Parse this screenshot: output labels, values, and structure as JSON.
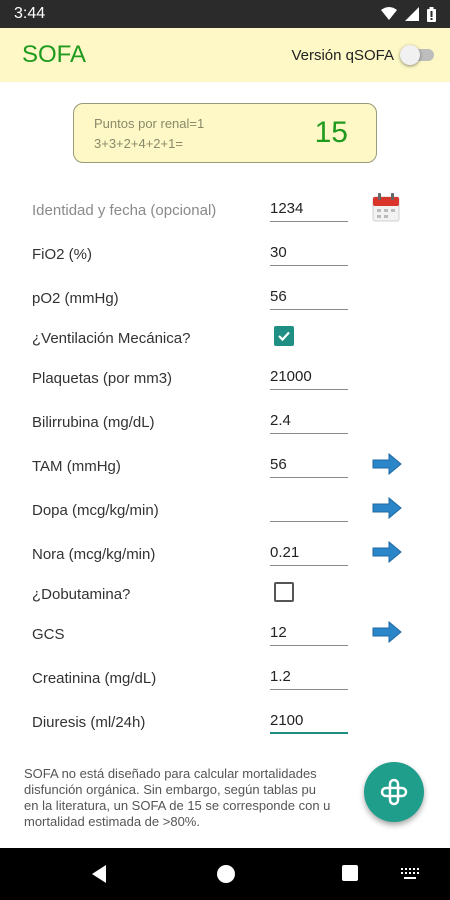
{
  "status_bar": {
    "time": "3:44"
  },
  "app_bar": {
    "title": "SOFA",
    "qsofa_label": "Versión qSOFA",
    "qsofa_enabled": false
  },
  "score": {
    "line1": "Puntos por renal=1",
    "line2": "3+3+2+4+2+1=",
    "total": "15"
  },
  "fields": {
    "identity": {
      "label": "Identidad y fecha (opcional)",
      "value": "1234"
    },
    "fio2": {
      "label": "FiO2 (%)",
      "value": "30"
    },
    "po2": {
      "label": "pO2 (mmHg)",
      "value": "56"
    },
    "ventilation": {
      "label": "¿Ventilación Mecánica?",
      "checked": true
    },
    "platelets": {
      "label": "Plaquetas (por mm3)",
      "value": "21000"
    },
    "bilirubin": {
      "label": "Bilirrubina (mg/dL)",
      "value": "2.4"
    },
    "tam": {
      "label": "TAM (mmHg)",
      "value": "56"
    },
    "dopa": {
      "label": "Dopa (mcg/kg/min)",
      "value": ""
    },
    "nora": {
      "label": "Nora (mcg/kg/min)",
      "value": "0.21"
    },
    "dobutamine": {
      "label": "¿Dobutamina?",
      "checked": false
    },
    "gcs": {
      "label": "GCS",
      "value": "12"
    },
    "creatinine": {
      "label": "Creatinina (mg/dL)",
      "value": "1.2"
    },
    "diuresis": {
      "label": "Diuresis (ml/24h)",
      "value": "2100"
    }
  },
  "footer": {
    "line1": "SOFA no está diseñado para calcular mortalidades",
    "line2": "disfunción orgánica. Sin embargo, según tablas pu",
    "line3": "en la literatura, un SOFA de 15 se corresponde con u",
    "line4": "mortalidad estimada de >80%."
  },
  "icons": {
    "fab": "plus-icon",
    "arrow": "arrow-right-icon",
    "calendar": "calendar-icon"
  },
  "colors": {
    "accent": "#1f9e8c",
    "title_green": "#1e9a1e",
    "header_bg": "#fdf8c6",
    "arrow_blue": "#2b86c9"
  }
}
